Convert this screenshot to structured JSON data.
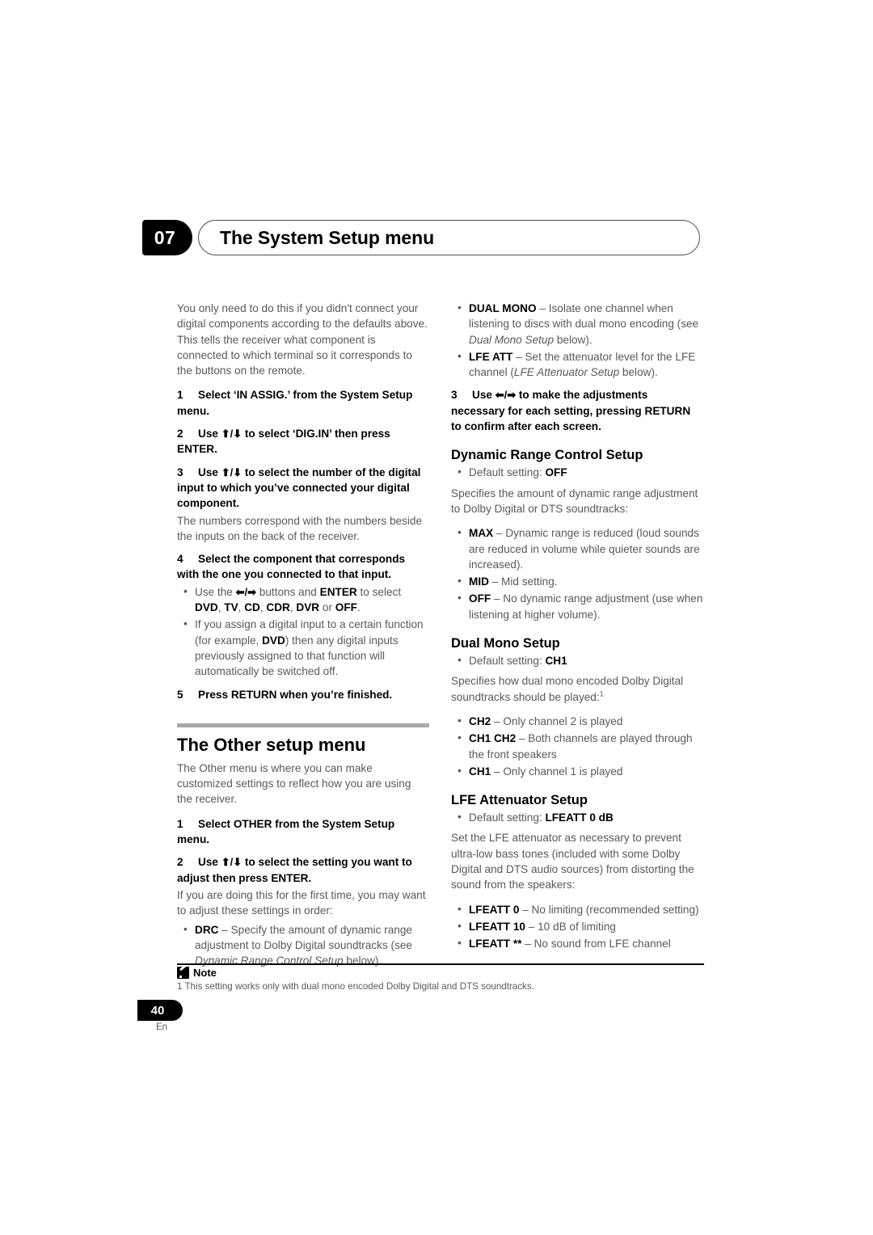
{
  "header": {
    "chapter_number": "07",
    "chapter_title": "The System Setup menu"
  },
  "left_column": {
    "intro_paragraph": "You only need to do this if you didn't connect your digital components according to the defaults above. This tells the receiver what component is connected to which terminal so it corresponds to the buttons on the remote.",
    "steps": [
      {
        "num": "1",
        "text": "Select ‘IN ASSIG.’ from the System Setup menu."
      },
      {
        "num": "2",
        "text_before": "Use ",
        "arrows": "⬆/⬇",
        "text_after": " to select ‘DIG.IN’ then press ENTER."
      },
      {
        "num": "3",
        "text_before": "Use ",
        "arrows": "⬆/⬇",
        "text_after": " to select the number of the digital input to which you’ve connected your digital component.",
        "follow": "The numbers correspond with the numbers beside the inputs on the back of the receiver."
      },
      {
        "num": "4",
        "text": "Select the component that corresponds with the one you connected to that input."
      },
      {
        "num": "5",
        "text": "Press RETURN when you’re finished."
      }
    ],
    "step4_bullets": [
      {
        "seg": [
          {
            "t": "Use the ",
            "s": "normal"
          },
          {
            "t": "⬅/➡",
            "s": "arrow"
          },
          {
            "t": " buttons and ",
            "s": "normal"
          },
          {
            "t": "ENTER",
            "s": "bold"
          },
          {
            "t": " to select ",
            "s": "normal"
          },
          {
            "t": "DVD",
            "s": "bold"
          },
          {
            "t": ", ",
            "s": "normal"
          },
          {
            "t": "TV",
            "s": "bold"
          },
          {
            "t": ", ",
            "s": "normal"
          },
          {
            "t": "CD",
            "s": "bold"
          },
          {
            "t": ", ",
            "s": "normal"
          },
          {
            "t": "CDR",
            "s": "bold"
          },
          {
            "t": ", ",
            "s": "normal"
          },
          {
            "t": "DVR",
            "s": "bold"
          },
          {
            "t": " or ",
            "s": "normal"
          },
          {
            "t": "OFF",
            "s": "bold"
          },
          {
            "t": ".",
            "s": "normal"
          }
        ]
      },
      {
        "seg": [
          {
            "t": "If you assign a digital input to a certain function (for example, ",
            "s": "normal"
          },
          {
            "t": "DVD",
            "s": "bold"
          },
          {
            "t": ") then any digital inputs previously assigned to that function will automatically be switched off.",
            "s": "normal"
          }
        ]
      }
    ],
    "section": {
      "title": "The Other setup menu",
      "intro": "The Other menu is where you can make customized settings to reflect how you are using the receiver.",
      "steps": [
        {
          "num": "1",
          "text": "Select OTHER from the System Setup menu."
        },
        {
          "num": "2",
          "text_before": "Use ",
          "arrows": "⬆/⬇",
          "text_after": " to select the setting you want to adjust then press ENTER.",
          "follow": "If you are doing this for the first time, you may want to adjust these settings in order:"
        }
      ],
      "bullets": [
        {
          "seg": [
            {
              "t": "DRC",
              "s": "bold"
            },
            {
              "t": " – Specify the amount of dynamic range adjustment to Dolby Digital soundtracks (see ",
              "s": "normal"
            },
            {
              "t": "Dynamic Range Control Setup",
              "s": "italic"
            },
            {
              "t": " below).",
              "s": "normal"
            }
          ]
        }
      ]
    }
  },
  "right_column": {
    "bullets_top": [
      {
        "seg": [
          {
            "t": "DUAL MONO",
            "s": "bold"
          },
          {
            "t": " – Isolate one channel when listening to discs with dual mono encoding (see ",
            "s": "normal"
          },
          {
            "t": "Dual Mono Setup",
            "s": "italic"
          },
          {
            "t": " below).",
            "s": "normal"
          }
        ]
      },
      {
        "seg": [
          {
            "t": "LFE ATT",
            "s": "bold"
          },
          {
            "t": " – Set the attenuator level for the LFE channel (",
            "s": "normal"
          },
          {
            "t": "LFE Attenuator Setup",
            "s": "italic"
          },
          {
            "t": " below).",
            "s": "normal"
          }
        ]
      }
    ],
    "step3": {
      "num": "3",
      "text_before": "Use ",
      "arrows": "⬅/➡",
      "text_after": " to make the adjustments necessary for each setting, pressing RETURN to confirm after each screen."
    },
    "drc": {
      "title": "Dynamic Range Control Setup",
      "default_label": "Default setting: ",
      "default_value": "OFF",
      "intro": "Specifies the amount of dynamic range adjustment to Dolby Digital or DTS soundtracks:",
      "bullets": [
        {
          "seg": [
            {
              "t": "MAX",
              "s": "bold"
            },
            {
              "t": " – Dynamic range is reduced (loud sounds are reduced in volume while quieter sounds are increased).",
              "s": "normal"
            }
          ]
        },
        {
          "seg": [
            {
              "t": "MID",
              "s": "bold"
            },
            {
              "t": " – Mid setting.",
              "s": "normal"
            }
          ]
        },
        {
          "seg": [
            {
              "t": "OFF",
              "s": "bold"
            },
            {
              "t": " – No dynamic range adjustment (use when listening at higher volume).",
              "s": "normal"
            }
          ]
        }
      ]
    },
    "dual_mono": {
      "title": "Dual Mono Setup",
      "default_label": "Default setting: ",
      "default_value": "CH1",
      "intro_before": "Specifies how dual mono encoded Dolby Digital soundtracks should be played:",
      "intro_sup": "1",
      "bullets": [
        {
          "seg": [
            {
              "t": "CH2",
              "s": "bold"
            },
            {
              "t": " – Only channel 2 is played",
              "s": "normal"
            }
          ]
        },
        {
          "seg": [
            {
              "t": "CH1 CH2",
              "s": "bold"
            },
            {
              "t": " – Both channels are played through the front speakers",
              "s": "normal"
            }
          ]
        },
        {
          "seg": [
            {
              "t": "CH1",
              "s": "bold"
            },
            {
              "t": " – Only channel 1 is played",
              "s": "normal"
            }
          ]
        }
      ]
    },
    "lfe": {
      "title": "LFE Attenuator Setup",
      "default_label": "Default setting: ",
      "default_value": "LFEATT 0 dB",
      "intro": "Set the LFE attenuator as necessary to prevent ultra-low bass tones (included with some Dolby Digital and DTS audio sources) from distorting the sound from the speakers:",
      "bullets": [
        {
          "seg": [
            {
              "t": "LFEATT 0",
              "s": "bold"
            },
            {
              "t": " – No limiting (recommended setting)",
              "s": "normal"
            }
          ]
        },
        {
          "seg": [
            {
              "t": "LFEATT 10",
              "s": "bold"
            },
            {
              "t": " – 10 dB of limiting",
              "s": "normal"
            }
          ]
        },
        {
          "seg": [
            {
              "t": "LFEATT **",
              "s": "bold"
            },
            {
              "t": " – No sound from LFE channel",
              "s": "normal"
            }
          ]
        }
      ]
    }
  },
  "note": {
    "label": "Note",
    "text": "1 This setting works only with dual mono encoded Dolby Digital and DTS soundtracks."
  },
  "footer": {
    "page_number": "40",
    "language": "En"
  }
}
